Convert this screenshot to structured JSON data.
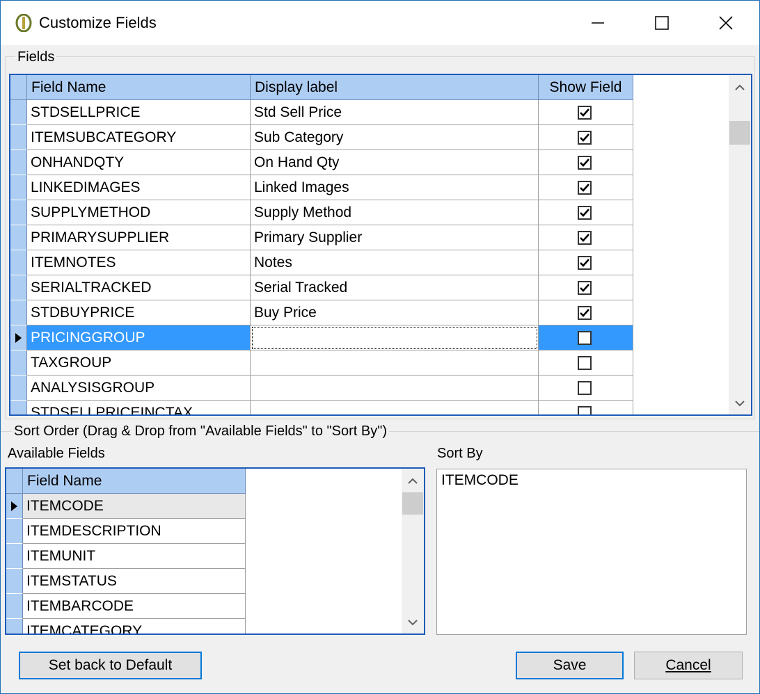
{
  "window": {
    "title": "Customize Fields"
  },
  "fields_group": {
    "label": "Fields",
    "columns": [
      "Field Name",
      "Display label",
      "Show Field"
    ],
    "rows": [
      {
        "name": "STDSELLPRICE",
        "label": "Std Sell Price",
        "show": true
      },
      {
        "name": "ITEMSUBCATEGORY",
        "label": "Sub Category",
        "show": true
      },
      {
        "name": "ONHANDQTY",
        "label": "On Hand Qty",
        "show": true
      },
      {
        "name": "LINKEDIMAGES",
        "label": "Linked Images",
        "show": true
      },
      {
        "name": "SUPPLYMETHOD",
        "label": "Supply Method",
        "show": true
      },
      {
        "name": "PRIMARYSUPPLIER",
        "label": "Primary Supplier",
        "show": true
      },
      {
        "name": "ITEMNOTES",
        "label": "Notes",
        "show": true
      },
      {
        "name": "SERIALTRACKED",
        "label": "Serial Tracked",
        "show": true
      },
      {
        "name": "STDBUYPRICE",
        "label": "Buy Price",
        "show": true
      },
      {
        "name": "PRICINGGROUP",
        "label": "",
        "show": false,
        "selected": true
      },
      {
        "name": "TAXGROUP",
        "label": "",
        "show": false
      },
      {
        "name": "ANALYSISGROUP",
        "label": "",
        "show": false
      },
      {
        "name": "STDSELLPRICEINCTAX",
        "label": "",
        "show": false
      }
    ]
  },
  "sort_group": {
    "label": "Sort Order (Drag & Drop from \"Available Fields\" to \"Sort By\")",
    "available_label": "Available Fields",
    "available_column": "Field Name",
    "available_rows": [
      "ITEMCODE",
      "ITEMDESCRIPTION",
      "ITEMUNIT",
      "ITEMSTATUS",
      "ITEMBARCODE",
      "ITEMCATEGORY"
    ],
    "sort_by_label": "Sort By",
    "sort_by_items": [
      "ITEMCODE"
    ]
  },
  "buttons": {
    "default_label": "Set back to Default",
    "save_label": "Save",
    "cancel_label": "Cancel"
  },
  "colors": {
    "selection": "#3399ff",
    "header": "#aecdf2",
    "grid_border": "#1e5bb8"
  }
}
